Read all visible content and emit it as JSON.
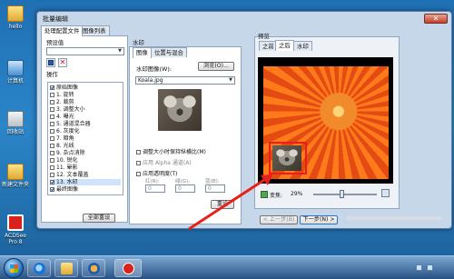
{
  "desktop": {
    "icons": [
      {
        "label": "hello",
        "icon": "folder-icon"
      },
      {
        "label": "计算机",
        "icon": "computer-icon"
      },
      {
        "label": "回收站",
        "icon": "recycle-bin-icon"
      },
      {
        "label": "新建文件夹",
        "icon": "folder-icon"
      },
      {
        "label": "ACDSee Pro 8",
        "icon": "acdsee-icon"
      }
    ]
  },
  "window": {
    "title": "批量编辑",
    "close_symbol": "✕",
    "tabs": [
      {
        "label": "处理配置文件",
        "active": true
      },
      {
        "label": "图像列表",
        "active": false
      }
    ],
    "preset_label": "预设值",
    "preset_value": "",
    "operations_label": "操作",
    "operations": [
      {
        "label": "原始图像",
        "checked": true
      },
      {
        "label": "1. 旋转",
        "checked": false
      },
      {
        "label": "2. 裁剪",
        "checked": false
      },
      {
        "label": "3. 调整大小",
        "checked": false
      },
      {
        "label": "4. 曝光",
        "checked": false
      },
      {
        "label": "5. 通道混合器",
        "checked": false
      },
      {
        "label": "6. 灰度化",
        "checked": false
      },
      {
        "label": "7. 暗角",
        "checked": false
      },
      {
        "label": "8. 光线",
        "checked": false
      },
      {
        "label": "9. 杂点消除",
        "checked": false
      },
      {
        "label": "10. 锐化",
        "checked": false
      },
      {
        "label": "11. 晕影",
        "checked": false
      },
      {
        "label": "12. 文本覆盖",
        "checked": false
      },
      {
        "label": "13. 水印",
        "checked": true,
        "selected": true
      },
      {
        "label": "最终图像",
        "checked": true
      }
    ],
    "reset_all_button": "全部重设",
    "watermark": {
      "group_label": "水印",
      "tabs": [
        {
          "label": "图像",
          "active": true
        },
        {
          "label": "位置与混合",
          "active": false
        }
      ],
      "image_label": "水印图像(W):",
      "browse_button": "浏览(O)...",
      "file_value": "Koala.jpg",
      "options": [
        {
          "label": "调整大小时保持纵横比(M)",
          "checked": false
        },
        {
          "label": "应用 Alpha 通道(A)",
          "checked": false
        },
        {
          "label": "应用透明度(T)",
          "checked": false
        }
      ],
      "rgb_labels": [
        "红(R):",
        "绿(G):",
        "蓝(B):"
      ],
      "rgb_values": [
        "0",
        "0",
        "0"
      ],
      "reset_button": "重设"
    },
    "preview": {
      "group_label": "预览",
      "tabs": [
        {
          "label": "之前",
          "active": false
        },
        {
          "label": "之后",
          "active": true
        },
        {
          "label": "水印",
          "active": false
        }
      ],
      "zoom_label": "变焦:",
      "zoom_value": "29%"
    },
    "nav": {
      "back_button": "< 上一步(B)",
      "next_button": "下一步(N) >"
    }
  },
  "colors": {
    "highlight_red": "#e8201a",
    "selection_blue": "#cfe3fb"
  }
}
